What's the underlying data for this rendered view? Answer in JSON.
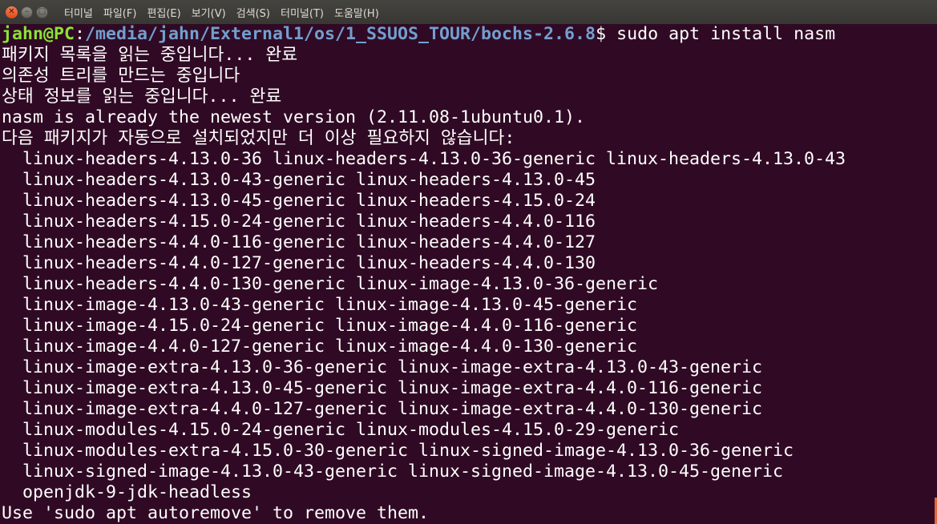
{
  "window": {
    "controls": [
      "close",
      "minimize",
      "maximize"
    ],
    "menu": [
      "터미널",
      "파일(F)",
      "편집(E)",
      "보기(V)",
      "검색(S)",
      "터미널(T)",
      "도움말(H)"
    ]
  },
  "prompt": {
    "user": "jahn@PC",
    "path": "/media/jahn/External1/os/1_SSUOS_TOUR/bochs-2.6.8",
    "command": "$ sudo apt install nasm"
  },
  "output": [
    "패키지 목록을 읽는 중입니다... 완료",
    "의존성 트리를 만드는 중입니다",
    "상태 정보를 읽는 중입니다... 완료",
    "nasm is already the newest version (2.11.08-1ubuntu0.1).",
    "다음 패키지가 자동으로 설치되었지만 더 이상 필요하지 않습니다:",
    "  linux-headers-4.13.0-36 linux-headers-4.13.0-36-generic linux-headers-4.13.0-43",
    "  linux-headers-4.13.0-43-generic linux-headers-4.13.0-45",
    "  linux-headers-4.13.0-45-generic linux-headers-4.15.0-24",
    "  linux-headers-4.15.0-24-generic linux-headers-4.4.0-116",
    "  linux-headers-4.4.0-116-generic linux-headers-4.4.0-127",
    "  linux-headers-4.4.0-127-generic linux-headers-4.4.0-130",
    "  linux-headers-4.4.0-130-generic linux-image-4.13.0-36-generic",
    "  linux-image-4.13.0-43-generic linux-image-4.13.0-45-generic",
    "  linux-image-4.15.0-24-generic linux-image-4.4.0-116-generic",
    "  linux-image-4.4.0-127-generic linux-image-4.4.0-130-generic",
    "  linux-image-extra-4.13.0-36-generic linux-image-extra-4.13.0-43-generic",
    "  linux-image-extra-4.13.0-45-generic linux-image-extra-4.4.0-116-generic",
    "  linux-image-extra-4.4.0-127-generic linux-image-extra-4.4.0-130-generic",
    "  linux-modules-4.15.0-24-generic linux-modules-4.15.0-29-generic",
    "  linux-modules-extra-4.15.0-30-generic linux-signed-image-4.13.0-36-generic",
    "  linux-signed-image-4.13.0-43-generic linux-signed-image-4.13.0-45-generic",
    "  openjdk-9-jdk-headless",
    "Use 'sudo apt autoremove' to remove them."
  ],
  "colors": {
    "background": "#300a24",
    "user": "#8ae234",
    "path": "#729fcf",
    "scrollbar": "#e2693a"
  }
}
